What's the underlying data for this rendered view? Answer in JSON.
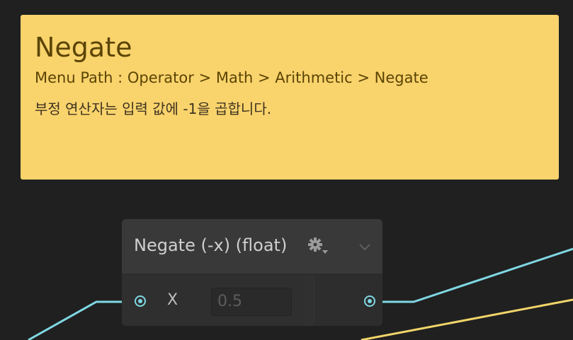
{
  "sticky_note": {
    "title": "Negate",
    "menu_path": "Menu Path : Operator > Math > Arithmetic > Negate",
    "description": "부정 연산자는 입력 값에 -1을 곱합니다."
  },
  "node": {
    "title": "Negate (-x) (float)",
    "settings_icon": "gear-icon",
    "collapse_icon": "chevron-down-icon",
    "input": {
      "label": "X",
      "value": "0.5"
    }
  },
  "colors": {
    "background": "#202020",
    "sticky_note": "#f9d36c",
    "float_wire": "#7fd8e3",
    "other_wire": "#f1d56a",
    "node_header": "#393939",
    "node_body": "#2f2f2f"
  }
}
